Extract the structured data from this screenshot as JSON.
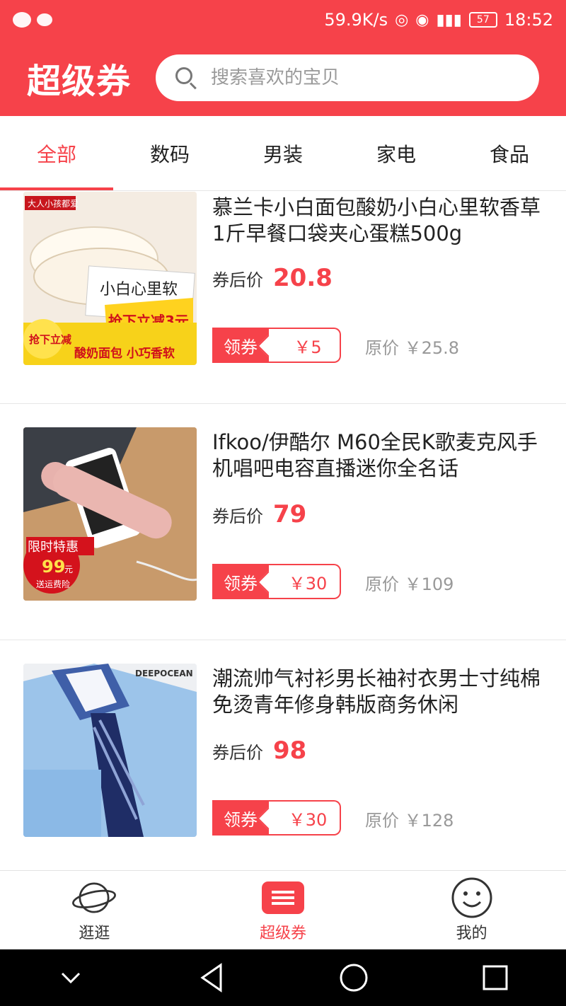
{
  "status_bar": {
    "speed": "59.9K/s",
    "battery": "57",
    "time": "18:52",
    "icons": [
      "wechat-icon",
      "message-icon",
      "hotspot-icon",
      "eye-icon",
      "signal-icon",
      "battery-icon"
    ]
  },
  "header": {
    "title": "超级券",
    "search_placeholder": "搜索喜欢的宝贝"
  },
  "tabs": [
    {
      "label": "全部",
      "active": true
    },
    {
      "label": "数码",
      "active": false
    },
    {
      "label": "男装",
      "active": false
    },
    {
      "label": "家电",
      "active": false
    },
    {
      "label": "食品",
      "active": false
    }
  ],
  "products": [
    {
      "title": "慕兰卡小白面包酸奶小白心里软香草1斤早餐口袋夹心蛋糕500g",
      "after_label": "券后价",
      "after_price": "20.8",
      "coupon_label": "领券",
      "coupon_value": "￥5",
      "orig_price": "原价 ￥25.8",
      "image_texts": [
        "大人小孩都爱",
        "小白心里软",
        "抢下立减3元",
        "抢下立减",
        "酸奶面包 小巧香软"
      ]
    },
    {
      "title": "Ifkoo/伊酷尔 M60全民K歌麦克风手机唱吧电容直播迷你全名话",
      "after_label": "券后价",
      "after_price": "79",
      "coupon_label": "领券",
      "coupon_value": "￥30",
      "orig_price": "原价 ￥109",
      "image_texts": [
        "限时特惠",
        "99",
        "元",
        "送运费险"
      ]
    },
    {
      "title": "潮流帅气衬衫男长袖衬衣男士寸纯棉免烫青年修身韩版商务休闲",
      "after_label": "券后价",
      "after_price": "98",
      "coupon_label": "领券",
      "coupon_value": "￥30",
      "orig_price": "原价 ￥128",
      "image_texts": [
        "DEEPOCEAN"
      ]
    }
  ],
  "bottom_nav": [
    {
      "label": "逛逛",
      "icon": "planet-icon",
      "active": false
    },
    {
      "label": "超级券",
      "icon": "menu-icon",
      "active": true
    },
    {
      "label": "我的",
      "icon": "smiley-icon",
      "active": false
    }
  ],
  "colors": {
    "accent": "#f6424a",
    "text": "#222222",
    "muted": "#999999"
  }
}
